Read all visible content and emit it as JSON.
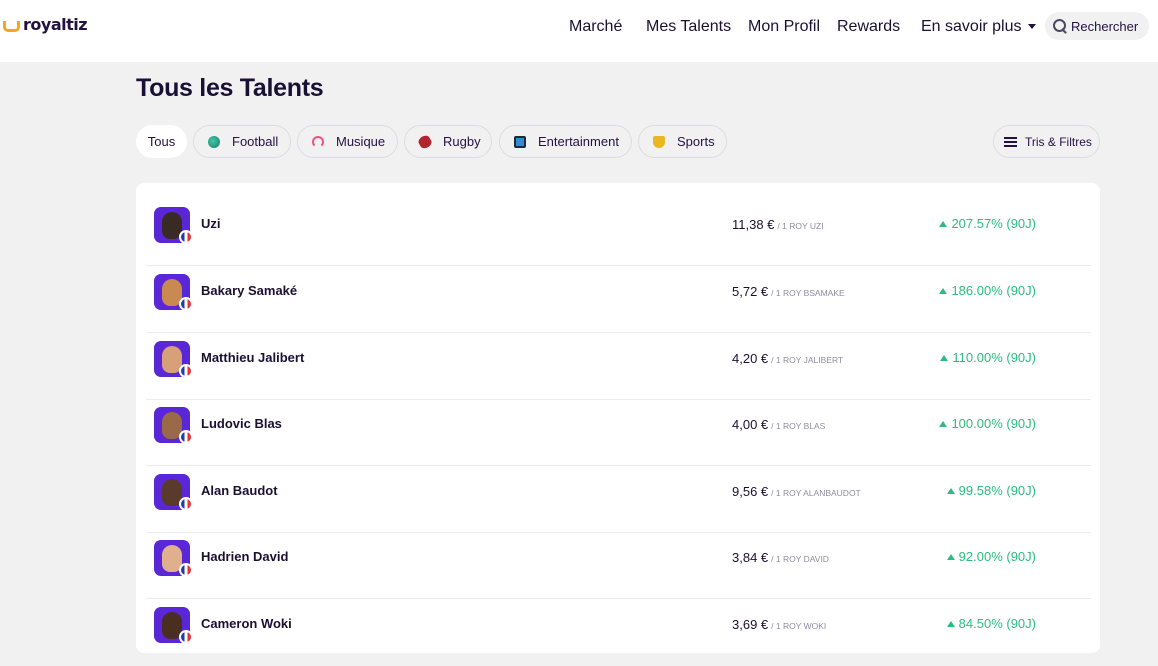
{
  "brand": {
    "name": "royaltiz"
  },
  "nav": {
    "items": [
      "Marché",
      "Mes Talents",
      "Mon Profil",
      "Rewards"
    ],
    "more_label": "En savoir plus",
    "search_label": "Rechercher"
  },
  "page": {
    "title": "Tous les Talents"
  },
  "categories": [
    {
      "label": "Tous",
      "icon": ""
    },
    {
      "label": "Football",
      "icon": "football-icon"
    },
    {
      "label": "Musique",
      "icon": "headphones-icon"
    },
    {
      "label": "Rugby",
      "icon": "rugby-ball-icon"
    },
    {
      "label": "Entertainment",
      "icon": "screen-icon"
    },
    {
      "label": "Sports",
      "icon": "trophy-icon"
    }
  ],
  "filters_label": "Tris & Filtres",
  "talents": [
    {
      "name": "Uzi",
      "price": "11,38 €",
      "unit": "/ 1 ROY UZI",
      "performance": "207.57% (90J)"
    },
    {
      "name": "Bakary Samaké",
      "price": "5,72 €",
      "unit": "/ 1 ROY BSAMAKE",
      "performance": "186.00% (90J)"
    },
    {
      "name": "Matthieu Jalibert",
      "price": "4,20 €",
      "unit": "/ 1 ROY JALIBERT",
      "performance": "110.00% (90J)"
    },
    {
      "name": "Ludovic Blas",
      "price": "4,00 €",
      "unit": "/ 1 ROY BLAS",
      "performance": "100.00% (90J)"
    },
    {
      "name": "Alan Baudot",
      "price": "9,56 €",
      "unit": "/ 1 ROY ALANBAUDOT",
      "performance": "99.58% (90J)"
    },
    {
      "name": "Hadrien David",
      "price": "3,84 €",
      "unit": "/ 1 ROY DAVID",
      "performance": "92.00% (90J)"
    },
    {
      "name": "Cameron Woki",
      "price": "3,69 €",
      "unit": "/ 1 ROY WOKI",
      "performance": "84.50% (90J)"
    }
  ],
  "colors": {
    "accent": "#5a27d6",
    "positive": "#2cbc7f",
    "brand": "#f2a81d",
    "text": "#1a1033"
  }
}
